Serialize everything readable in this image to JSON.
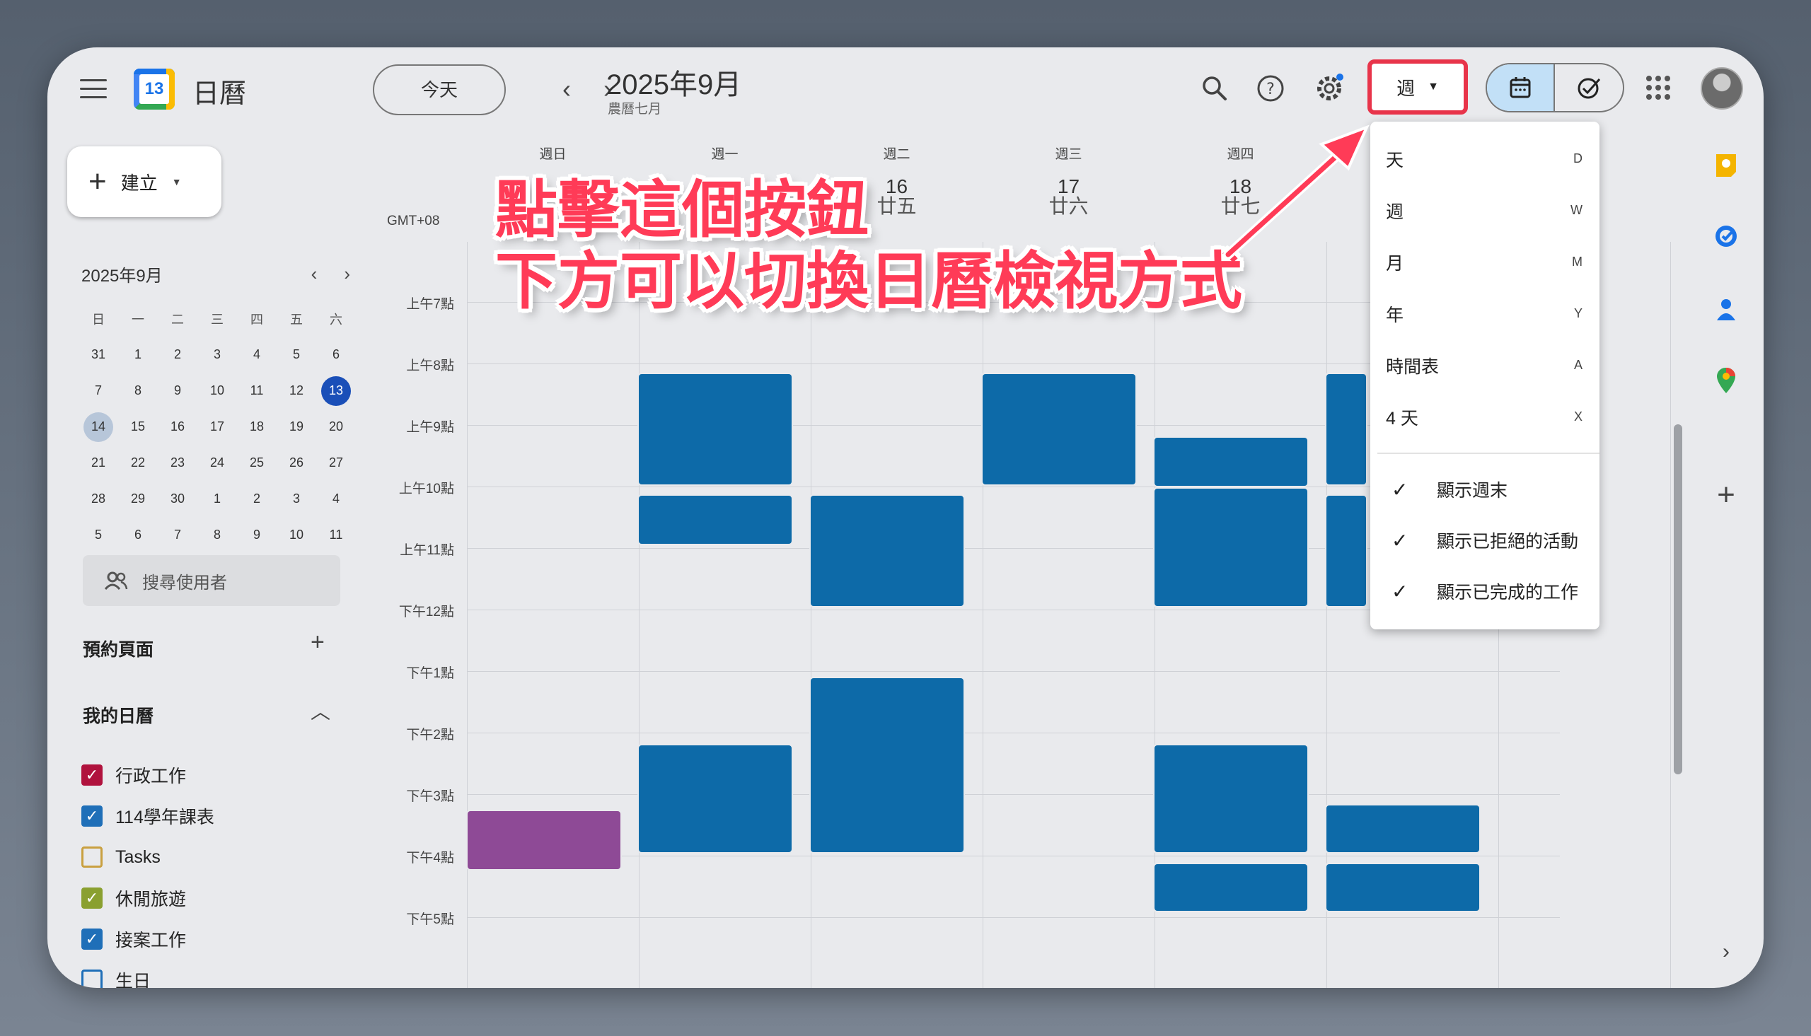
{
  "header": {
    "app_title": "日曆",
    "logo_day": "13",
    "today_label": "今天",
    "prev_icon": "chevron-left-icon",
    "next_icon": "chevron-right-icon",
    "month_title": "2025年9月",
    "lunar_month": "農曆七月",
    "view_label": "週"
  },
  "sidebar": {
    "create_label": "建立",
    "mini_cal": {
      "title": "2025年9月",
      "weekdays": [
        "日",
        "一",
        "二",
        "三",
        "四",
        "五",
        "六"
      ],
      "days": [
        "31",
        "1",
        "2",
        "3",
        "4",
        "5",
        "6",
        "7",
        "8",
        "9",
        "10",
        "11",
        "12",
        "13",
        "14",
        "15",
        "16",
        "17",
        "18",
        "19",
        "20",
        "21",
        "22",
        "23",
        "24",
        "25",
        "26",
        "27",
        "28",
        "29",
        "30",
        "1",
        "2",
        "3",
        "4",
        "5",
        "6",
        "7",
        "8",
        "9",
        "10",
        "11"
      ],
      "today_index": 13,
      "selected_index": 14
    },
    "search_users_placeholder": "搜尋使用者",
    "booking_title": "預約頁面",
    "my_calendars_title": "我的日曆",
    "calendars": [
      {
        "label": "行政工作",
        "checked": true,
        "color": "#b0123d"
      },
      {
        "label": "114學年課表",
        "checked": true,
        "color": "#1f6fb8"
      },
      {
        "label": "Tasks",
        "checked": false,
        "color": "#c9a040"
      },
      {
        "label": "休閒旅遊",
        "checked": true,
        "color": "#8aa030"
      },
      {
        "label": "接案工作",
        "checked": true,
        "color": "#1f6fb8"
      },
      {
        "label": "生日",
        "checked": false,
        "color": "#1f6fb8"
      }
    ]
  },
  "grid": {
    "timezone": "GMT+08",
    "days": [
      {
        "weekday": "週日",
        "date": "",
        "lunar": ""
      },
      {
        "weekday": "週一",
        "date": "",
        "lunar": ""
      },
      {
        "weekday": "週二",
        "date": "16",
        "lunar": "廿五"
      },
      {
        "weekday": "週三",
        "date": "17",
        "lunar": "廿六"
      },
      {
        "weekday": "週四",
        "date": "18",
        "lunar": "廿七"
      }
    ],
    "hours": [
      "上午7點",
      "上午8點",
      "上午9點",
      "上午10點",
      "上午11點",
      "下午12點",
      "下午1點",
      "下午2點",
      "下午3點",
      "下午4點",
      "下午5點"
    ]
  },
  "dropdown": {
    "views": [
      {
        "label": "天",
        "key": "D"
      },
      {
        "label": "週",
        "key": "W"
      },
      {
        "label": "月",
        "key": "M"
      },
      {
        "label": "年",
        "key": "Y"
      },
      {
        "label": "時間表",
        "key": "A"
      },
      {
        "label": "4 天",
        "key": "X"
      }
    ],
    "options": [
      {
        "label": "顯示週末",
        "checked": true
      },
      {
        "label": "顯示已拒絕的活動",
        "checked": true
      },
      {
        "label": "顯示已完成的工作",
        "checked": true
      }
    ]
  },
  "annotation": {
    "line1": "點擊這個按鈕",
    "line2": "下方可以切換日曆檢視方式",
    "color": "#ff3b57"
  },
  "colors": {
    "event_blue": "#0d6aa8",
    "event_purple": "#8e4a96",
    "highlight_red": "#e8344a",
    "today_blue": "#1a4fb8"
  }
}
